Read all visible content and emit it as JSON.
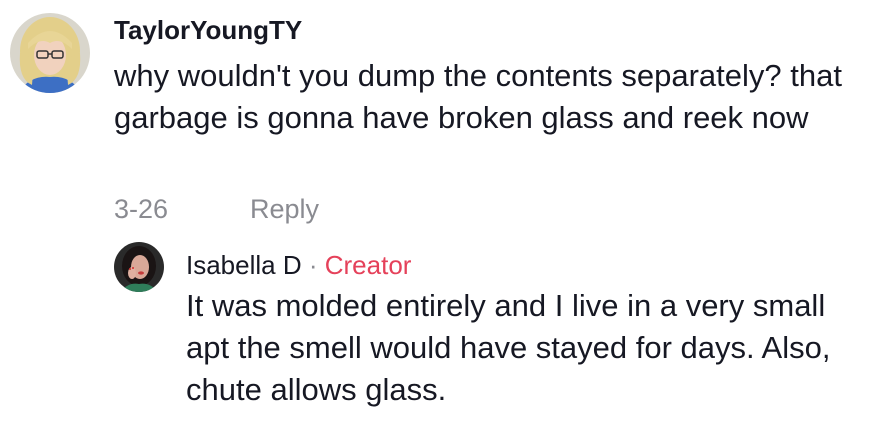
{
  "comment": {
    "avatar_icon": "user-avatar-blonde",
    "username": "TaylorYoungTY",
    "text": "why wouldn't you dump the contents separately? that garbage is gonna have broken glass and reek now",
    "date": "3-26",
    "reply_label": "Reply"
  },
  "reply": {
    "avatar_icon": "user-avatar-creator",
    "username": "Isabella D",
    "separator": " · ",
    "badge": "Creator",
    "text": "It was molded entirely and I live in a very small apt the smell would have stayed for days. Also, chute allows glass."
  },
  "colors": {
    "text_primary": "#161823",
    "text_secondary": "#8a8b91",
    "creator_badge": "#e5415a"
  }
}
